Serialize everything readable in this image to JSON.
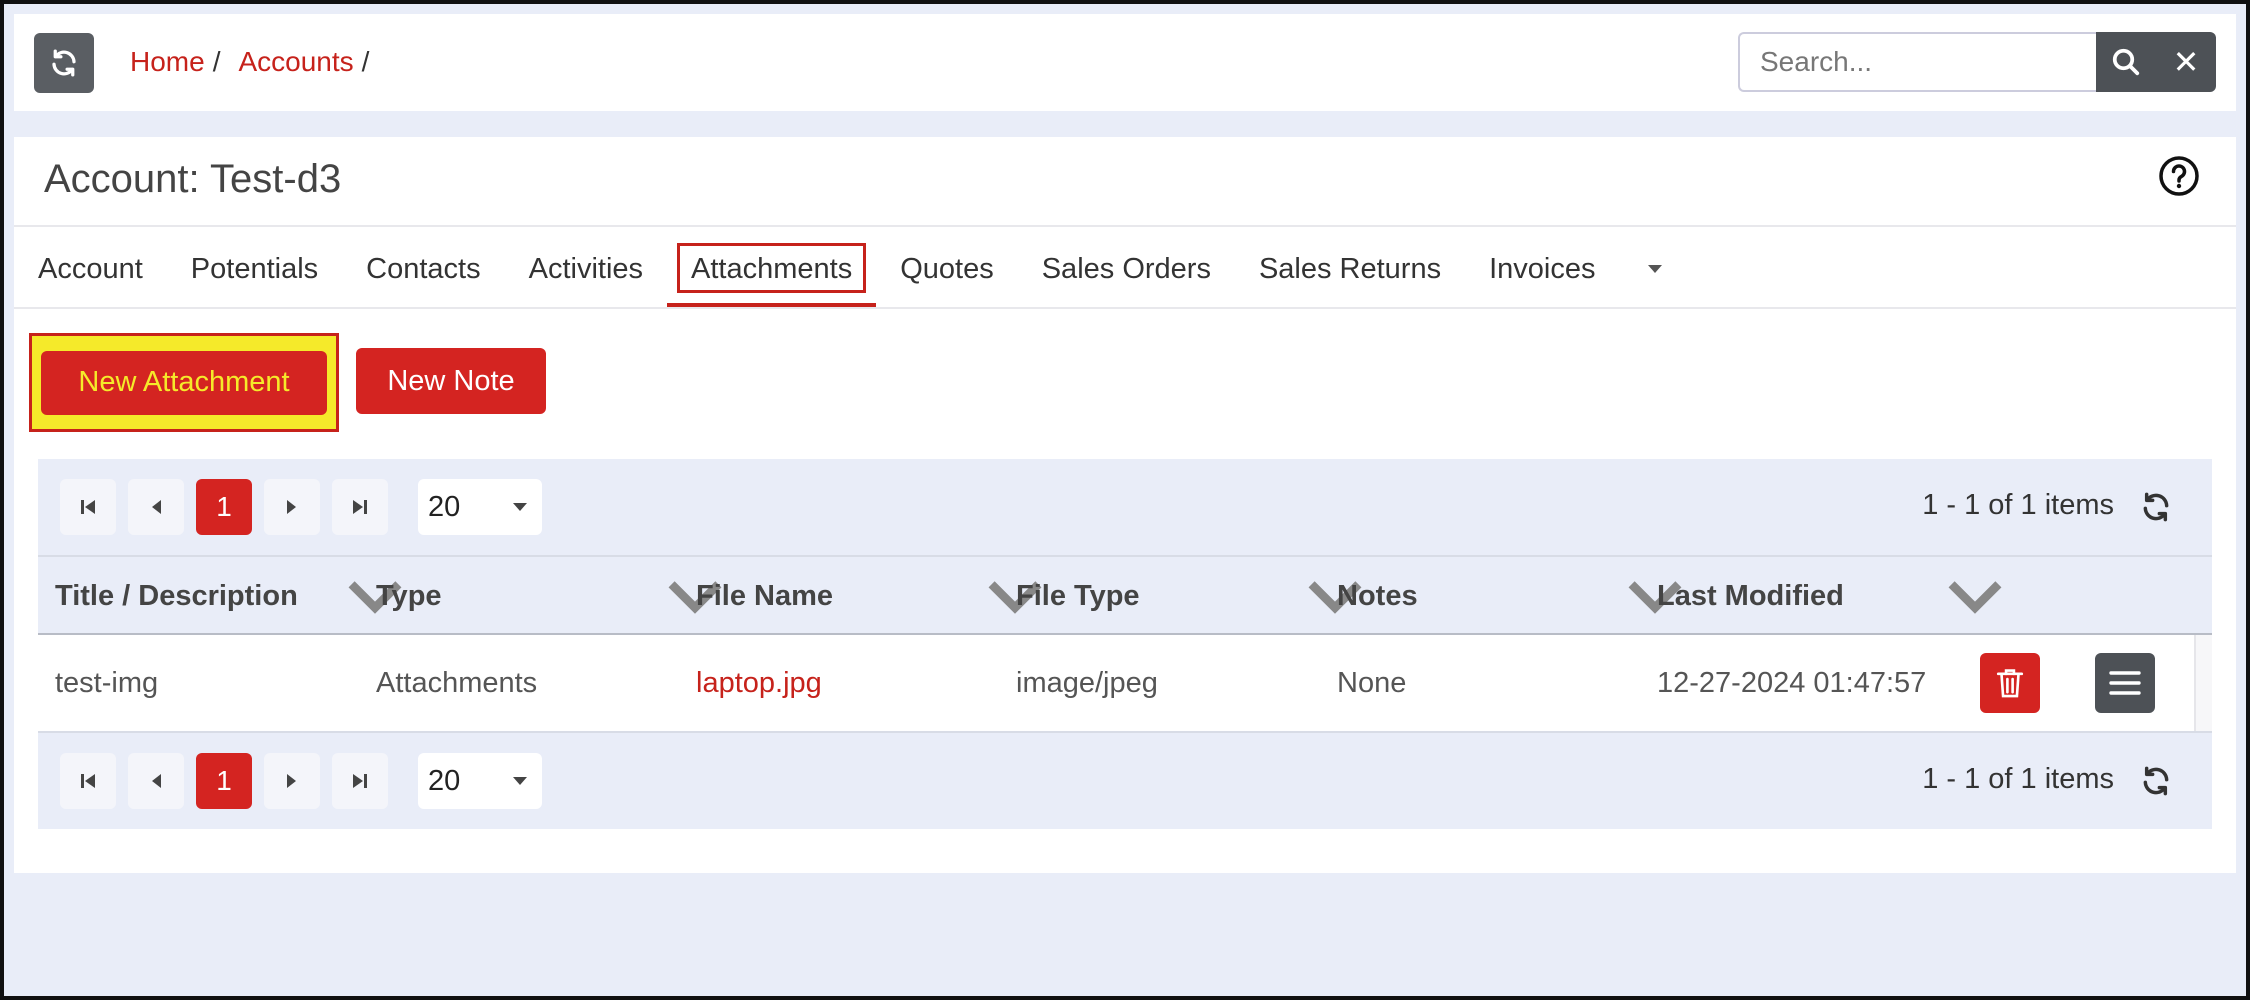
{
  "header": {
    "breadcrumb": [
      {
        "label": "Home",
        "sep": "/"
      },
      {
        "label": "Accounts",
        "sep": "/"
      }
    ],
    "search": {
      "placeholder": "Search..."
    },
    "clear_label": "✕"
  },
  "page": {
    "title": "Account: Test-d3"
  },
  "tabs": [
    {
      "label": "Account"
    },
    {
      "label": "Potentials"
    },
    {
      "label": "Contacts"
    },
    {
      "label": "Activities"
    },
    {
      "label": "Attachments",
      "active": true
    },
    {
      "label": "Quotes"
    },
    {
      "label": "Sales Orders"
    },
    {
      "label": "Sales Returns"
    },
    {
      "label": "Invoices"
    }
  ],
  "actions": {
    "new_attachment": "New Attachment",
    "new_note": "New Note"
  },
  "pager": {
    "current_page": "1",
    "page_size": "20",
    "info": "1 - 1 of 1 items"
  },
  "table": {
    "columns": [
      "Title / Description",
      "Type",
      "File Name",
      "File Type",
      "Notes",
      "Last Modified"
    ],
    "rows": [
      {
        "title": "test-img",
        "type": "Attachments",
        "file_name": "laptop.jpg",
        "file_type": "image/jpeg",
        "notes": "None",
        "last_modified": "12-27-2024 01:47:57"
      }
    ]
  },
  "colors": {
    "accent": "#d42421",
    "link": "#c6221b",
    "highlight": "#f5ea2a",
    "dark_button": "#4d5156",
    "background": "#e9edf8"
  },
  "icons": {
    "refresh": "refresh-icon",
    "search": "search-icon",
    "close": "close-icon",
    "help": "help-circle-icon",
    "delete": "trash-icon",
    "menu": "hamburger-menu-icon"
  }
}
